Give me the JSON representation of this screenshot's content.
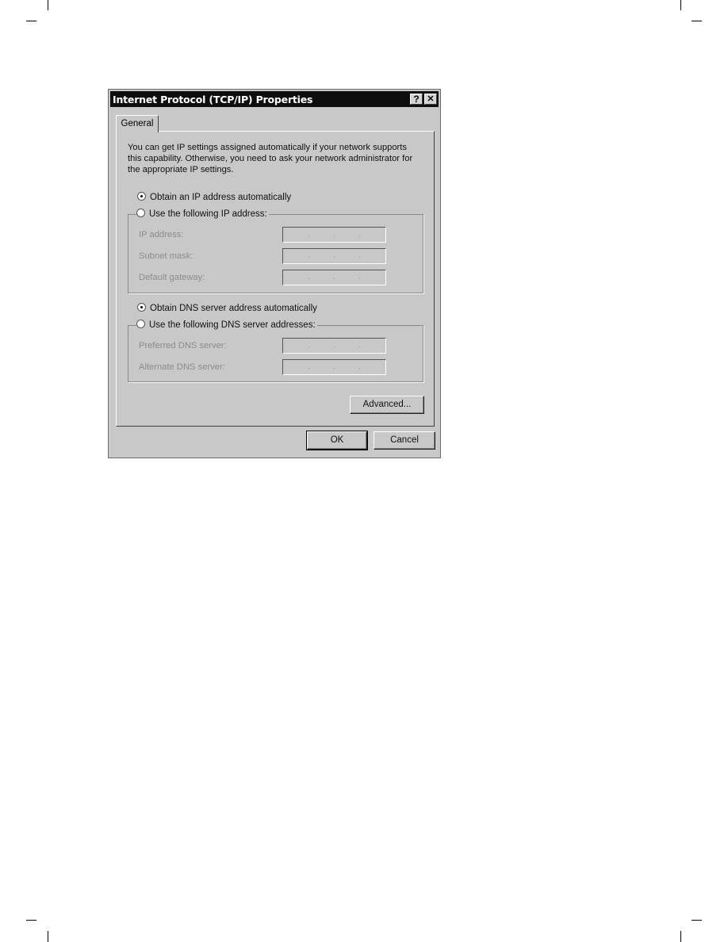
{
  "dialog": {
    "title": "Internet Protocol (TCP/IP) Properties",
    "help_button": "?",
    "close_button": "✕",
    "tabs": [
      {
        "label": "General",
        "active": true
      }
    ],
    "description": "You can get IP settings assigned automatically if your network supports this capability. Otherwise, you need to ask your network administrator for the appropriate IP settings.",
    "ip_mode": {
      "auto_label": "Obtain an IP address automatically",
      "manual_label": "Use the following IP address:",
      "selected": "auto"
    },
    "ip_fields": [
      {
        "label": "IP address:",
        "value": ". . ."
      },
      {
        "label": "Subnet mask:",
        "value": ". . ."
      },
      {
        "label": "Default gateway:",
        "value": ". . ."
      }
    ],
    "dns_mode": {
      "auto_label": "Obtain DNS server address automatically",
      "manual_label": "Use the following DNS server addresses:",
      "selected": "auto"
    },
    "dns_fields": [
      {
        "label": "Preferred DNS server:",
        "value": ". . ."
      },
      {
        "label": "Alternate DNS server:",
        "value": ". . ."
      }
    ],
    "advanced_button": "Advanced...",
    "ok_button": "OK",
    "cancel_button": "Cancel"
  }
}
